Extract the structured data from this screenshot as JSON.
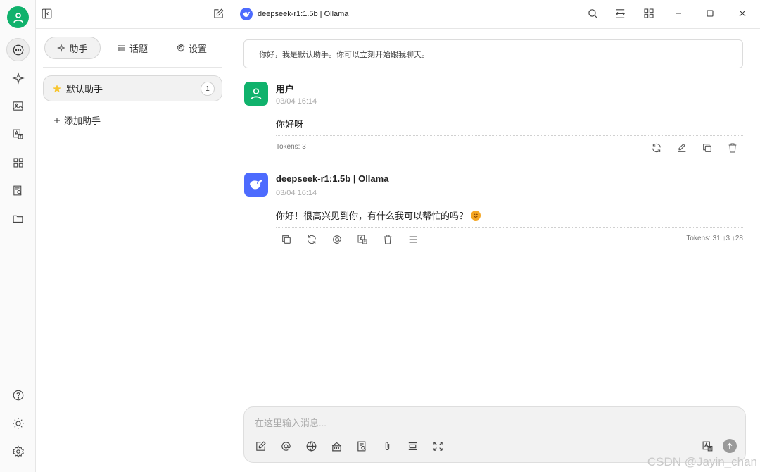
{
  "window": {
    "model_title": "deepseek-r1:1.5b | Ollama"
  },
  "tabs": [
    {
      "label": "助手"
    },
    {
      "label": "话题"
    },
    {
      "label": "设置"
    }
  ],
  "assistants": {
    "items": [
      {
        "label": "默认助手",
        "count": "1"
      }
    ],
    "add_label": "添加助手"
  },
  "chat": {
    "intro": "你好，我是默认助手。你可以立刻开始跟我聊天。",
    "messages": [
      {
        "name": "用户",
        "time": "03/04 16:14",
        "text": "你好呀",
        "tokens": "Tokens: 3"
      },
      {
        "name": "deepseek-r1:1.5b | Ollama",
        "time": "03/04 16:14",
        "text": "你好！很高兴见到你，有什么我可以帮忙的吗？",
        "tokens": "Tokens: 31 ↑3 ↓28"
      }
    ]
  },
  "input": {
    "placeholder": "在这里输入消息..."
  },
  "watermark": "CSDN @Jayin_chan",
  "colors": {
    "brand_green": "#10b26c",
    "deepseek_blue": "#4d6bfe"
  }
}
